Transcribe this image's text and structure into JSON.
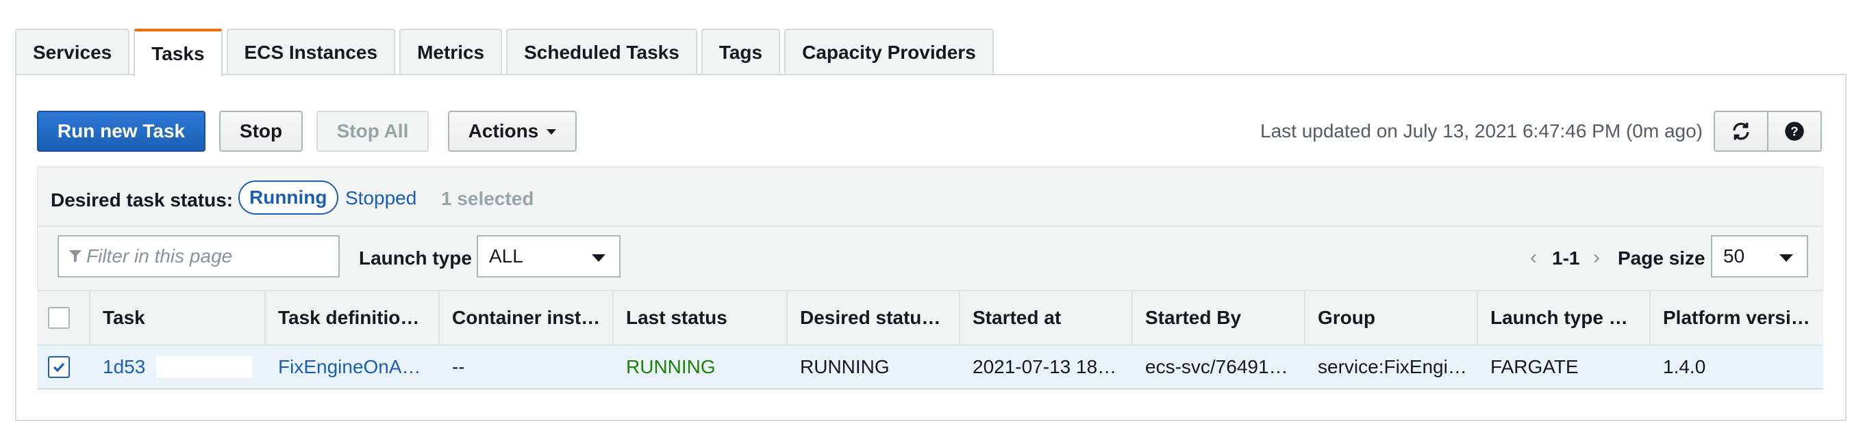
{
  "tabs": [
    {
      "label": "Services",
      "active": false
    },
    {
      "label": "Tasks",
      "active": true
    },
    {
      "label": "ECS Instances",
      "active": false
    },
    {
      "label": "Metrics",
      "active": false
    },
    {
      "label": "Scheduled Tasks",
      "active": false
    },
    {
      "label": "Tags",
      "active": false
    },
    {
      "label": "Capacity Providers",
      "active": false
    }
  ],
  "toolbar": {
    "run_new_task": "Run new Task",
    "stop": "Stop",
    "stop_all": "Stop All",
    "actions": "Actions",
    "last_updated": "Last updated on July 13, 2021 6:47:46 PM (0m ago)",
    "refresh_icon": "refresh-icon",
    "help_icon": "help-icon"
  },
  "status_filter": {
    "label": "Desired task status:",
    "running": "Running",
    "stopped": "Stopped",
    "selected": "1 selected"
  },
  "filters": {
    "search_placeholder": "Filter in this page",
    "launch_type_label": "Launch type",
    "launch_type_value": "ALL",
    "pagination": "1-1",
    "page_size_label": "Page size",
    "page_size_value": "50"
  },
  "table": {
    "columns": [
      "Task",
      "Task definitio…",
      "Container inst…",
      "Last status",
      "Desired statu…",
      "Started at",
      "Started By",
      "Group",
      "Launch type …",
      "Platform versi…"
    ],
    "rows": [
      {
        "checked": true,
        "task": "1d53",
        "task_definition": "FixEngineOnA…",
        "container_instance": "--",
        "last_status": "RUNNING",
        "desired_status": "RUNNING",
        "started_at": "2021-07-13 18…",
        "started_by": "ecs-svc/76491…",
        "group": "service:FixEngi…",
        "launch_type": "FARGATE",
        "platform_version": "1.4.0"
      }
    ]
  },
  "colors": {
    "accent_tab": "#ec7211",
    "primary_button": "#1a5fb4",
    "link": "#1a5fb4",
    "running_status": "#1d8102",
    "selected_row": "#eaf3fc"
  }
}
